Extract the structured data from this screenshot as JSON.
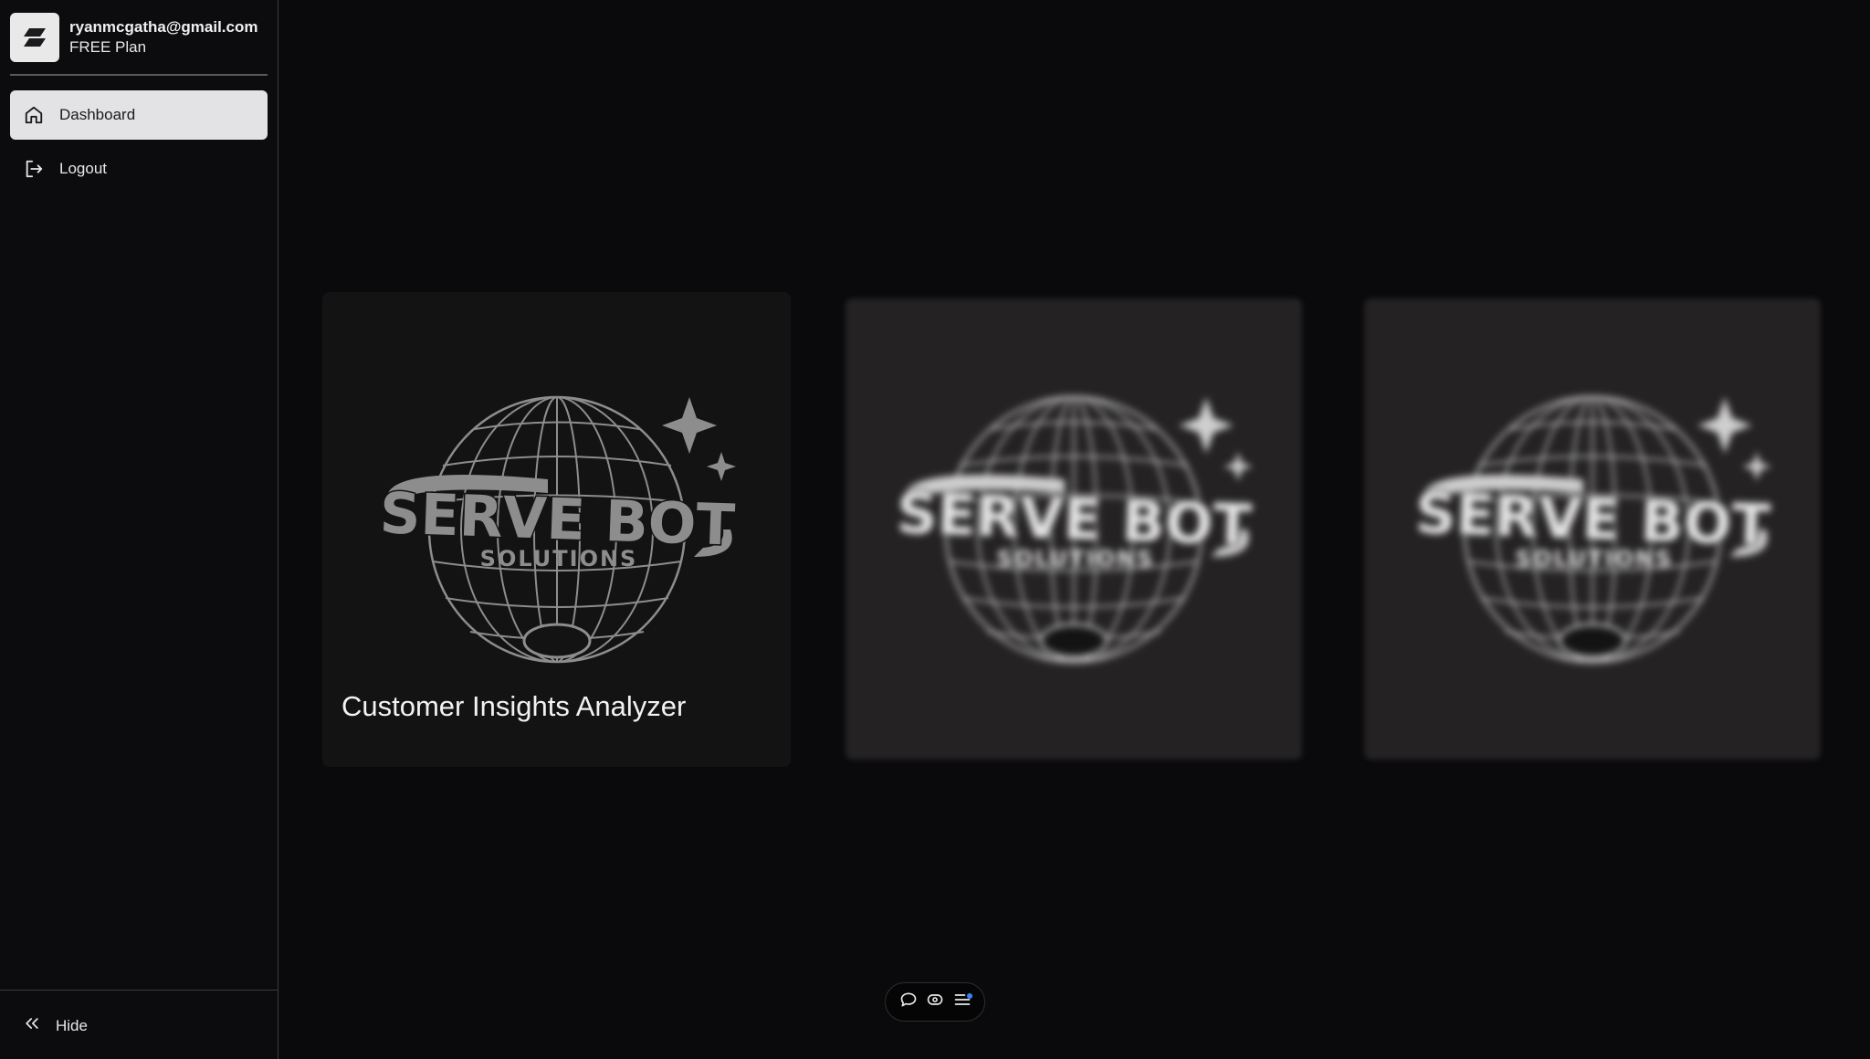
{
  "account": {
    "email": "ryanmcgatha@gmail.com",
    "plan": "FREE Plan",
    "avatar_icon": "brand-logo-icon"
  },
  "sidebar": {
    "items": [
      {
        "label": "Dashboard",
        "icon": "home-icon",
        "active": true
      },
      {
        "label": "Logout",
        "icon": "logout-icon",
        "active": false
      }
    ],
    "hide_label": "Hide",
    "hide_icon": "chevrons-left-icon"
  },
  "cards": [
    {
      "title": "Customer Insights Analyzer",
      "logo_top": "SERVE BOT",
      "logo_bottom": "SOLUTIONS",
      "blurred": false
    },
    {
      "title": "",
      "logo_top": "SERVE BOT",
      "logo_bottom": "SOLUTIONS",
      "blurred": true
    },
    {
      "title": "",
      "logo_top": "SERVE BOT",
      "logo_bottom": "SOLUTIONS",
      "blurred": true
    }
  ],
  "toolbar": {
    "buttons": [
      {
        "icon": "chat-bubble-icon"
      },
      {
        "icon": "eye-toggle-icon"
      },
      {
        "icon": "menu-list-icon",
        "badge_color": "#3b82f6"
      }
    ]
  }
}
